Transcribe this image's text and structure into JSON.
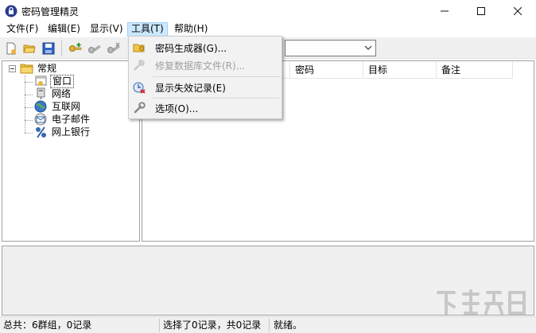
{
  "window": {
    "title": "密码管理精灵"
  },
  "menubar": {
    "items": [
      {
        "label": "文件(F)"
      },
      {
        "label": "编辑(E)"
      },
      {
        "label": "显示(V)"
      },
      {
        "label": "工具(T)"
      },
      {
        "label": "帮助(H)"
      }
    ],
    "active_index": 3
  },
  "toolbar": {
    "buttons": [
      "new-icon",
      "open-folder-icon",
      "save-icon",
      "add-key-icon",
      "edit-key-icon",
      "delete-key-icon"
    ]
  },
  "tools_menu": {
    "items": [
      {
        "label": "密码生成器(G)...",
        "icon": "key-generator-icon",
        "enabled": true
      },
      {
        "label": "修复数据库文件(R)...",
        "icon": "repair-icon",
        "enabled": false
      },
      {
        "label": "显示失效记录(E)",
        "icon": "expired-records-icon",
        "enabled": true
      },
      {
        "label": "选项(O)...",
        "icon": "wrench-icon",
        "enabled": true
      }
    ]
  },
  "tree": {
    "root": {
      "label": "常规",
      "icon": "folder-icon"
    },
    "children": [
      {
        "label": "窗口",
        "icon": "window-icon",
        "selected": true
      },
      {
        "label": "网络",
        "icon": "network-icon"
      },
      {
        "label": "互联网",
        "icon": "globe-icon"
      },
      {
        "label": "电子邮件",
        "icon": "email-icon"
      },
      {
        "label": "网上银行",
        "icon": "bank-icon"
      }
    ]
  },
  "list": {
    "columns": [
      "密码",
      "目标",
      "备注"
    ]
  },
  "statusbar": {
    "total": "总共：6群组，0记录",
    "selection": "选择了0记录，共0记录",
    "state": "就绪。"
  }
}
